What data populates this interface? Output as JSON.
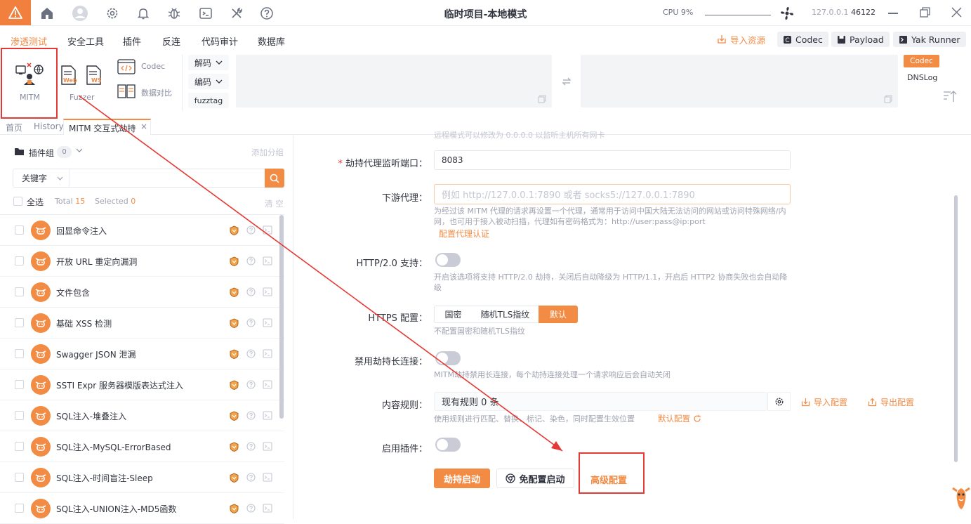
{
  "title_bar": {
    "title": "临时项目-本地模式",
    "cpu_label": "CPU",
    "cpu_value": "9%",
    "ip": "127.0.0.1",
    "port": "46122"
  },
  "menu": {
    "items": [
      "渗透测试",
      "安全工具",
      "插件",
      "反连",
      "代码审计",
      "数据库"
    ],
    "import_resources": "导入资源",
    "codec": "Codec",
    "payload": "Payload",
    "yak_runner": "Yak Runner"
  },
  "toolbar": {
    "mitm": "MITM",
    "fuzzer": "Fuzzer",
    "web_badge": "Web",
    "ws_badge": "WS",
    "codec": "Codec",
    "diff": "数据对比",
    "decode": "解码",
    "encode": "编码",
    "fuzztag": "fuzztag",
    "codec_tag": "Codec",
    "dnslog_tag": "DNSLog"
  },
  "tabs": [
    "首页",
    "History",
    "MITM 交互式劫持"
  ],
  "plugins": {
    "group_label": "插件组",
    "group_count": "0",
    "add_group": "添加分组",
    "keyword_select": "关键字",
    "select_all": "全选",
    "total_label": "Total",
    "total_value": "15",
    "selected_label": "Selected",
    "selected_value": "0",
    "clear": "清 空",
    "items": [
      "回显命令注入",
      "开放 URL 重定向漏洞",
      "文件包含",
      "基础 XSS 检测",
      "Swagger JSON 泄漏",
      "SSTI Expr 服务器模版表达式注入",
      "SQL注入-堆叠注入",
      "SQL注入-MySQL-ErrorBased",
      "SQL注入-时间盲注-Sleep",
      "SQL注入-UNION注入-MD5函数"
    ]
  },
  "form": {
    "top_hint": "远程模式可以修改为 0.0.0.0 以监听主机所有网卡",
    "port_label": "劫持代理监听端口：",
    "port_value": "8083",
    "downstream_label": "下游代理：",
    "downstream_placeholder": "例如 http://127.0.0.1:7890 或者 socks5://127.0.0.1:7890",
    "downstream_help": "为经过该 MITM 代理的请求再设置一个代理，通常用于访问中国大陆无法访问的网站或访问特殊网络/内网，也可用于接入被动扫描，代理如有密码格式为：http://user:pass@ip:port",
    "downstream_link": "配置代理认证",
    "http2_label": "HTTP/2.0 支持：",
    "http2_help": "开启该选项将支持 HTTP/2.0 劫持，关闭后自动降级为 HTTP/1.1，开启后 HTTP2 协商失败也会自动降级",
    "https_label": "HTTPS 配置：",
    "https_options": [
      "国密",
      "随机TLS指纹",
      "默认"
    ],
    "https_help": "不配置国密和随机TLS指纹",
    "keepalive_label": "禁用劫持长连接：",
    "keepalive_help": "MITM劫持禁用长连接，每个劫持连接处理一个请求响应后会自动关闭",
    "rules_label": "内容规则：",
    "rules_value": "现有规则 0 条",
    "import_config": "导入配置",
    "export_config": "导出配置",
    "rules_help": "使用规则进行匹配、替换、标记、染色，同时配置生效位置",
    "default_config": "默认配置",
    "plugins_label": "启用插件：",
    "start_button": "劫持启动",
    "free_start_button": "免配置启动",
    "advanced_button": "高级配置"
  },
  "colors": {
    "accent": "#f28b44",
    "highlight_box": "#e53935",
    "warning_bg": "#f17f3e"
  }
}
